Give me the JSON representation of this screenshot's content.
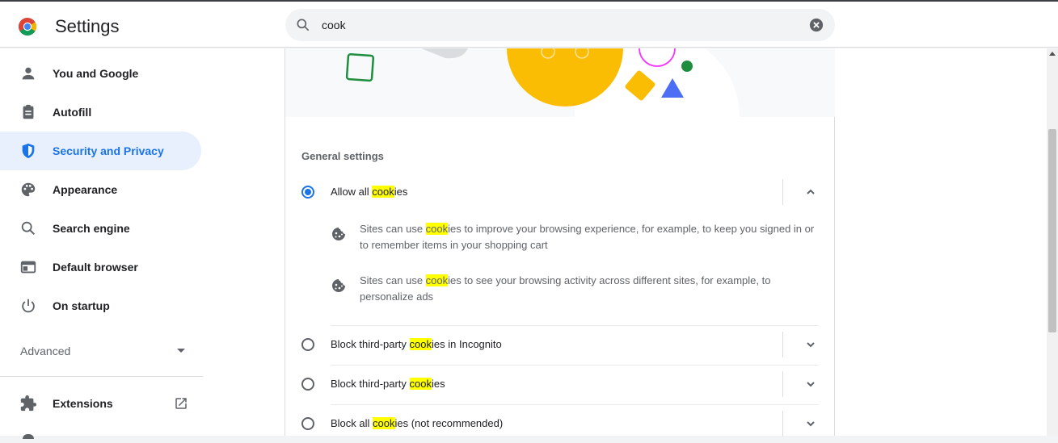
{
  "header": {
    "title": "Settings",
    "search": {
      "value": "cook",
      "placeholder": "Search settings"
    }
  },
  "sidebar": {
    "items": [
      {
        "label": "You and Google",
        "icon": "person-icon"
      },
      {
        "label": "Autofill",
        "icon": "clipboard-icon"
      },
      {
        "label": "Security and Privacy",
        "icon": "shield-icon",
        "active": true
      },
      {
        "label": "Appearance",
        "icon": "palette-icon"
      },
      {
        "label": "Search engine",
        "icon": "search-icon"
      },
      {
        "label": "Default browser",
        "icon": "browser-window-icon"
      },
      {
        "label": "On startup",
        "icon": "power-icon"
      }
    ],
    "advanced_label": "Advanced",
    "extensions_label": "Extensions"
  },
  "cookies": {
    "section_title": "General settings",
    "options": [
      {
        "pre": "Allow all ",
        "hl": "cook",
        "post": "ies",
        "selected": true,
        "expanded": true
      },
      {
        "pre": "Block third-party ",
        "hl": "cook",
        "post": "ies in Incognito",
        "selected": false
      },
      {
        "pre": "Block third-party ",
        "hl": "cook",
        "post": "ies",
        "selected": false
      },
      {
        "pre": "Block all ",
        "hl": "cook",
        "post": "ies (not recommended)",
        "selected": false
      }
    ],
    "details": [
      {
        "pre": "Sites can use ",
        "hl": "cook",
        "post": "ies to improve your browsing experience, for example, to keep you signed in or to remember items in your shopping cart"
      },
      {
        "pre": "Sites can use ",
        "hl": "cook",
        "post": "ies to see your browsing activity across different sites, for example, to personalize ads"
      }
    ]
  },
  "colors": {
    "accent": "#1a73e8",
    "highlight": "#ffff00",
    "active_bg": "#e8f0fe"
  }
}
